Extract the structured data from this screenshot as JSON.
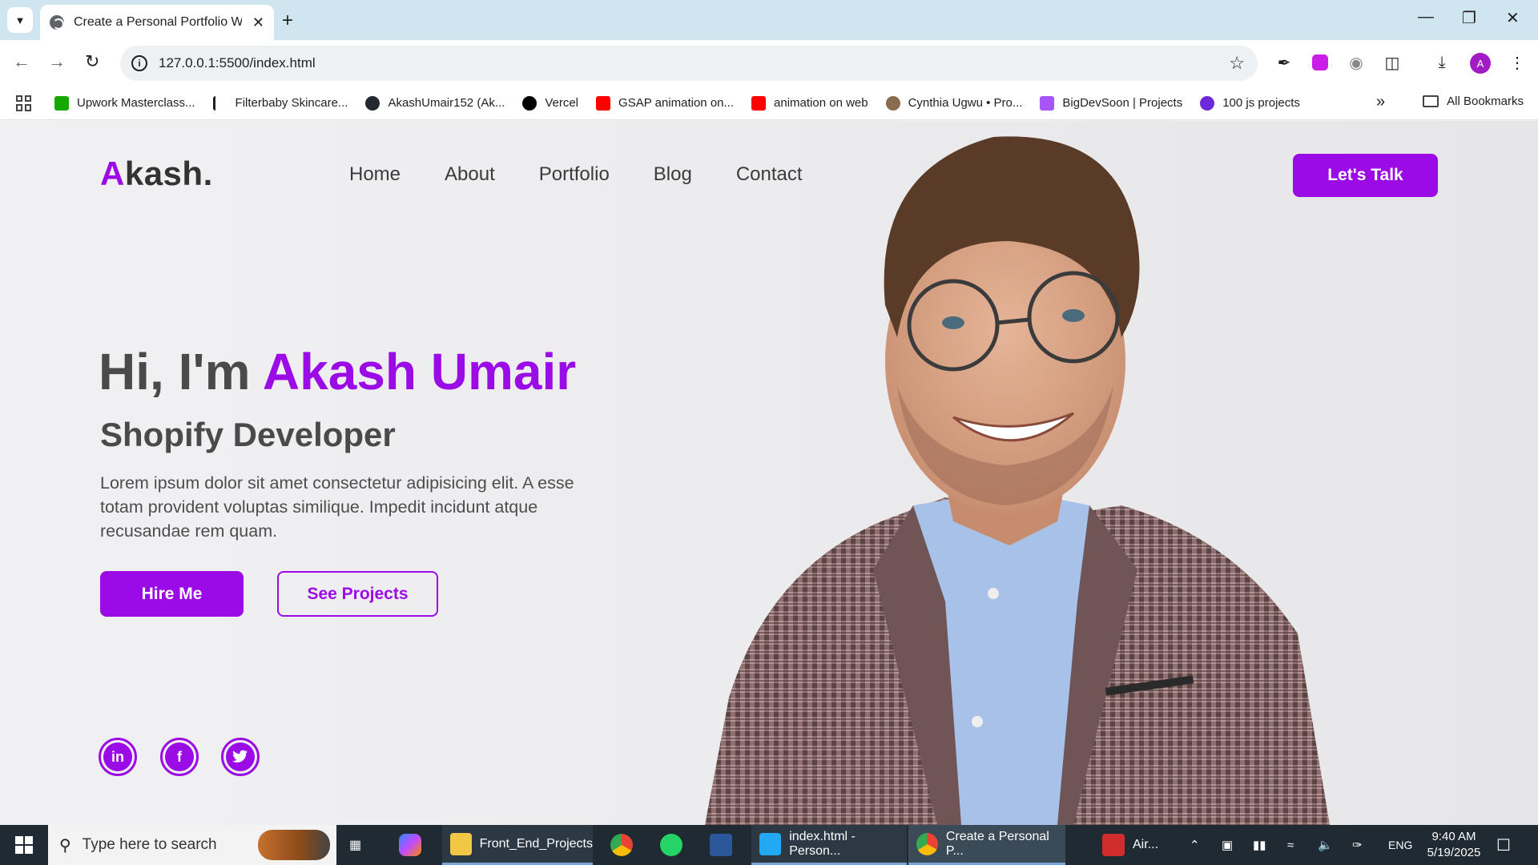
{
  "browser": {
    "tab_title": "Create a Personal Portfolio Web",
    "url": "127.0.0.1:5500/index.html",
    "bookmarks": [
      {
        "label": "Upwork Masterclass...",
        "color": "#14a800"
      },
      {
        "label": "Filterbaby Skincare...",
        "color": "#1f1f1f"
      },
      {
        "label": "AkashUmair152 (Ak...",
        "color": "#24292f"
      },
      {
        "label": "Vercel",
        "color": "#000000"
      },
      {
        "label": "GSAP animation on...",
        "color": "#ff0000"
      },
      {
        "label": "animation on web",
        "color": "#ff0000"
      },
      {
        "label": "Cynthia Ugwu • Pro...",
        "color": "#8a6b4e"
      },
      {
        "label": "BigDevSoon | Projects",
        "color": "#a855f7"
      },
      {
        "label": "100 js projects",
        "color": "#6d28d9"
      }
    ],
    "all_bookmarks": "All Bookmarks",
    "profile_initial": "A"
  },
  "site": {
    "logo_first": "A",
    "logo_rest": "kash.",
    "nav": [
      "Home",
      "About",
      "Portfolio",
      "Blog",
      "Contact"
    ],
    "cta": "Let's Talk",
    "hero_greeting": "Hi, I'm ",
    "hero_name": "Akash Umair",
    "hero_role": "Shopify Developer",
    "hero_desc": "Lorem ipsum dolor sit amet consectetur adipisicing elit. A esse totam provident voluptas similique. Impedit incidunt atque recusandae rem quam.",
    "hire_btn": "Hire Me",
    "projects_btn": "See Projects",
    "socials": [
      "in",
      "f",
      "t"
    ],
    "accent": "#9b0be6"
  },
  "taskbar": {
    "search_placeholder": "Type here to search",
    "items": [
      {
        "label": "Front_End_Projects",
        "icon": "folder-icon"
      },
      {
        "label": "index.html - Person...",
        "icon": "vscode-icon"
      },
      {
        "label": "Create a Personal P...",
        "icon": "chrome-icon"
      },
      {
        "label": "Air...",
        "icon": "air-icon"
      }
    ],
    "lang": "ENG",
    "time": "9:40 AM",
    "date": "5/19/2025"
  }
}
